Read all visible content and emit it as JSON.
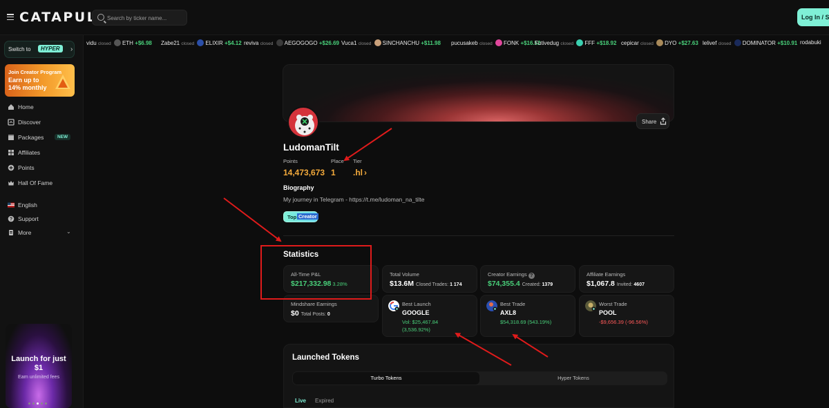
{
  "header": {
    "logo": "CATAPULT",
    "search_placeholder": "Search by ticker name...",
    "login_label": "Log In / Sign Up"
  },
  "sidebar": {
    "switch_label": "Switch to",
    "switch_badge": "HYPER",
    "creator_banner": {
      "line1": "Join Creator Program",
      "line2": "Earn up to",
      "line3": "14% monthly"
    },
    "items": [
      {
        "label": "Home",
        "icon": "home-icon"
      },
      {
        "label": "Discover",
        "icon": "discover-icon"
      },
      {
        "label": "Packages",
        "icon": "packages-icon",
        "badge": "NEW"
      },
      {
        "label": "Affiliates",
        "icon": "affiliates-icon"
      },
      {
        "label": "Points",
        "icon": "points-icon"
      },
      {
        "label": "Hall Of Fame",
        "icon": "crown-icon"
      }
    ],
    "secondary": [
      {
        "label": "English",
        "icon": "us-flag-icon"
      },
      {
        "label": "Support",
        "icon": "help-icon"
      },
      {
        "label": "More",
        "icon": "more-icon"
      }
    ],
    "promo": {
      "line1": "Launch for just",
      "line2": "$1",
      "line3": "Earn unlimited fees"
    }
  },
  "ticker": [
    {
      "user": "vidu",
      "status": "closed",
      "token": "ETH",
      "amount": "+$6.98"
    },
    {
      "user": "Zabe21",
      "status": "closed",
      "token": "ELIXIR",
      "amount": "+$4.12"
    },
    {
      "user": "reviva",
      "status": "closed",
      "token": "AEGOGOGO",
      "amount": "+$26.69"
    },
    {
      "user": "Vuca1",
      "status": "closed",
      "token": "SINCHANCHU",
      "amount": "+$11.98"
    },
    {
      "user": "pucusakeb",
      "status": "closed",
      "token": "FONK",
      "amount": "+$16.52"
    },
    {
      "user": "Futivedug",
      "status": "closed",
      "token": "FFF",
      "amount": "+$18.92"
    },
    {
      "user": "cepicar",
      "status": "closed",
      "token": "DYO",
      "amount": "+$27.63"
    },
    {
      "user": "lelivef",
      "status": "closed",
      "token": "DOMINATOR",
      "amount": "+$10.91"
    },
    {
      "user": "rodabuki",
      "status": "",
      "token": "",
      "amount": ""
    }
  ],
  "profile": {
    "username": "LudomanTilt",
    "share_label": "Share",
    "points_label": "Points",
    "points_value": "14,473,673",
    "place_label": "Place",
    "place_value": "1",
    "tier_label": "Tier",
    "tier_value": ".hl",
    "bio_title": "Biography",
    "bio_text": "My journey in Telegram - https://t.me/ludoman_na_tilte",
    "badge_part1": "Top",
    "badge_part2": "Creator"
  },
  "statistics": {
    "title": "Statistics",
    "pnl_label": "All-Time P&L",
    "pnl_value": "$217,332.98",
    "pnl_pct": "3.28%",
    "volume_label": "Total Volume",
    "volume_value": "$13.6M",
    "closed_trades_label": "Closed Trades:",
    "closed_trades_value": "1 174",
    "creator_label": "Creator Earnings",
    "creator_value": "$74,355.4",
    "created_label": "Created:",
    "created_value": "1379",
    "affiliate_label": "Affiliate Earnings",
    "affiliate_value": "$1,067.8",
    "invited_label": "Invited:",
    "invited_value": "4607",
    "mindshare_label": "Mindshare Earnings",
    "mindshare_value": "$0",
    "posts_label": "Total Posts:",
    "posts_value": "0",
    "best_launch_label": "Best Launch",
    "best_launch_token": "GOOGLE",
    "best_launch_vol": "Vol: $25,467.84",
    "best_launch_pct": "(3,536.92%)",
    "best_trade_label": "Best Trade",
    "best_trade_token": "AXL8",
    "best_trade_value": "$54,318.69 (543.19%)",
    "worst_trade_label": "Worst Trade",
    "worst_trade_token": "POOL",
    "worst_trade_value": "-$9,656.39 (-96.56%)"
  },
  "launched": {
    "title": "Launched Tokens",
    "tab_turbo": "Turbo Tokens",
    "tab_hyper": "Hyper Tokens",
    "filter_live": "Live",
    "filter_expired": "Expired"
  },
  "colors": {
    "accent": "#7ff0d6",
    "positive": "#49d07a",
    "negative": "#ff5a5a",
    "points": "#f2a93b",
    "annotation": "#e01b1b"
  }
}
